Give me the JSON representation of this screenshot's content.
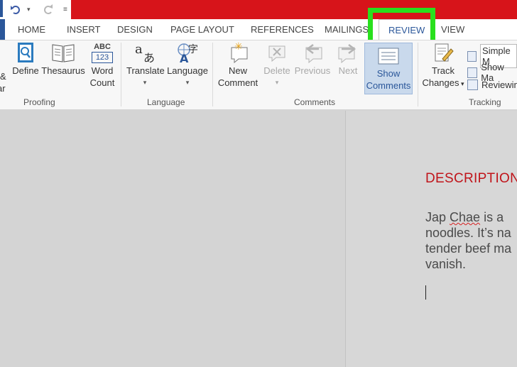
{
  "colors": {
    "title_bar": "#d7141a",
    "accent": "#2b579a",
    "highlight": "#29e01d",
    "heading": "#c0141a"
  },
  "quick_access": {
    "undo_icon": "undo-icon",
    "redo_icon": "redo-icon"
  },
  "tabs": [
    {
      "label": "HOME"
    },
    {
      "label": "INSERT"
    },
    {
      "label": "DESIGN"
    },
    {
      "label": "PAGE LAYOUT"
    },
    {
      "label": "REFERENCES"
    },
    {
      "label": "MAILINGS"
    },
    {
      "label": "REVIEW",
      "active": true
    },
    {
      "label": "VIEW"
    }
  ],
  "ribbon": {
    "proofing": {
      "label": "Proofing",
      "spelling_cut": [
        "&",
        "ar"
      ],
      "define": "Define",
      "thesaurus": "Thesaurus",
      "word_count": [
        "Word",
        "Count"
      ],
      "word_count_icon_text": [
        "ABC",
        "123"
      ]
    },
    "language": {
      "label": "Language",
      "translate": "Translate",
      "language": "Language",
      "language_icon_text": "字"
    },
    "comments": {
      "label": "Comments",
      "new_comment": [
        "New",
        "Comment"
      ],
      "delete": "Delete",
      "previous": "Previous",
      "next": "Next",
      "show_comments": [
        "Show",
        "Comments"
      ]
    },
    "tracking": {
      "label": "Tracking",
      "track_changes": [
        "Track",
        "Changes"
      ],
      "simple_markup": "Simple M",
      "show_markup": "Show Ma",
      "reviewing_pane": "Reviewin"
    }
  },
  "document": {
    "heading": "DESCRIPTION",
    "lines": [
      {
        "pre": "Jap ",
        "squiggle": "Chae",
        "post": " is a"
      },
      {
        "text": "noodles. It’s na"
      },
      {
        "text": "tender beef ma"
      },
      {
        "text": "vanish."
      }
    ]
  }
}
